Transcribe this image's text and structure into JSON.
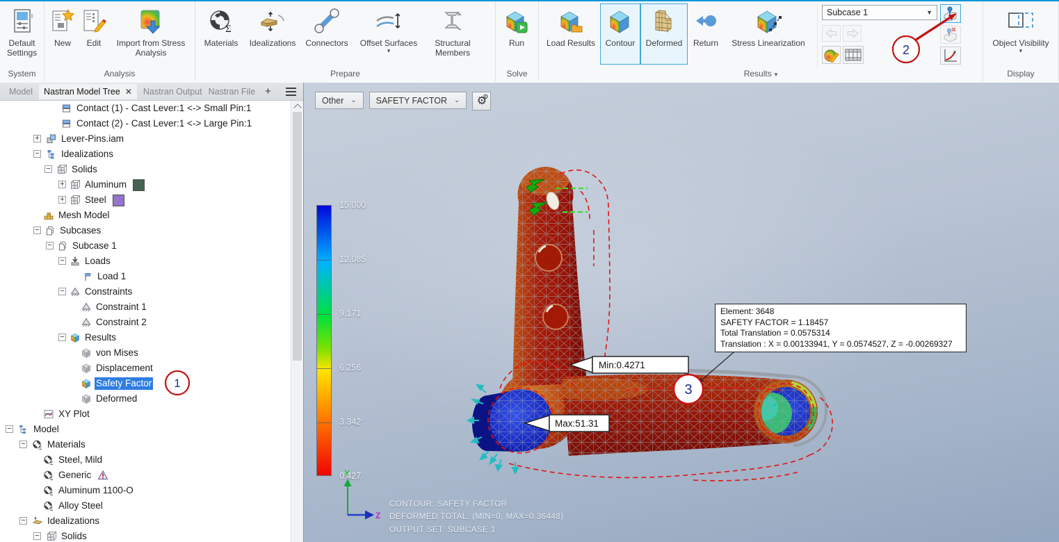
{
  "ribbon": {
    "group_labels": {
      "system": "System",
      "analysis": "Analysis",
      "prepare": "Prepare",
      "solve": "Solve",
      "results": "Results",
      "display": "Display"
    },
    "buttons": {
      "default_settings": "Default Settings",
      "new": "New",
      "edit": "Edit",
      "import_from_stress": "Import from Stress Analysis",
      "materials": "Materials",
      "idealizations": "Idealizations",
      "connectors": "Connectors",
      "offset_surfaces": "Offset Surfaces",
      "structural_members": "Structural Members",
      "run": "Run",
      "load_results": "Load Results",
      "contour": "Contour",
      "deformed": "Deformed",
      "return": "Return",
      "stress_linearization": "Stress Linearization",
      "object_visibility": "Object Visibility"
    },
    "active_buttons": [
      "Contour",
      "Deformed"
    ],
    "subcase_selector": "Subcase 1",
    "accent_color": "#0696d7"
  },
  "panel": {
    "tabs": {
      "model": "Model",
      "nastran_model_tree": "Nastran Model Tree",
      "close": "✕",
      "nastran_output": "Nastran Output",
      "nastran_file": "Nastran File",
      "add": "+"
    },
    "selection_color": "#2e7de1",
    "tree": [
      {
        "label": "Contact (1) - Cast Lever:1 <-> Small Pin:1",
        "ix": 88,
        "icon": "contact"
      },
      {
        "label": "Contact (2) - Cast Lever:1 <-> Large Pin:1",
        "ix": 88,
        "icon": "contact"
      },
      {
        "label": "Lever-Pins.iam",
        "ex": 48,
        "pm": "+",
        "ix": 66,
        "icon": "assembly"
      },
      {
        "label": "Idealizations",
        "ex": 48,
        "pm": "-",
        "ix": 66,
        "icon": "ideal"
      },
      {
        "label": "Solids",
        "ex": 64,
        "pm": "-",
        "ix": 81,
        "icon": "solids"
      },
      {
        "label": "Aluminum",
        "ex": 84,
        "pm": "+",
        "ix": 100,
        "icon": "solids",
        "swatch": "#456253"
      },
      {
        "label": "Steel",
        "ex": 84,
        "pm": "+",
        "ix": 100,
        "icon": "solids",
        "swatch": "#9674ce"
      },
      {
        "label": "Mesh Model",
        "ix": 62,
        "icon": "mesh"
      },
      {
        "label": "Subcases",
        "ex": 48,
        "pm": "-",
        "ix": 64,
        "icon": "pages"
      },
      {
        "label": "Subcase 1",
        "ex": 66,
        "pm": "-",
        "ix": 82,
        "icon": "pages"
      },
      {
        "label": "Loads",
        "ex": 84,
        "pm": "-",
        "ix": 100,
        "icon": "loads"
      },
      {
        "label": "Load 1",
        "ix": 118,
        "icon": "load1"
      },
      {
        "label": "Constraints",
        "ex": 84,
        "pm": "-",
        "ix": 100,
        "icon": "constraint"
      },
      {
        "label": "Constraint 1",
        "ix": 116,
        "icon": "constraint"
      },
      {
        "label": "Constraint 2",
        "ix": 116,
        "icon": "constraint"
      },
      {
        "label": "Results",
        "ex": 84,
        "pm": "-",
        "ix": 100,
        "icon": "cubecolor"
      },
      {
        "label": "von Mises",
        "ix": 116,
        "icon": "cubegrey"
      },
      {
        "label": "Displacement",
        "ix": 116,
        "icon": "cubegrey"
      },
      {
        "label": "Safety Factor",
        "ix": 116,
        "icon": "cubecolor",
        "sel": true
      },
      {
        "label": "Deformed",
        "ix": 116,
        "icon": "cubegrey"
      },
      {
        "label": "XY Plot",
        "ix": 62,
        "icon": "xyplot"
      },
      {
        "label": "Model",
        "ex": 8,
        "pm": "-",
        "ix": 26,
        "icon": "model"
      },
      {
        "label": "Materials",
        "ex": 28,
        "pm": "-",
        "ix": 46,
        "icon": "material"
      },
      {
        "label": "Steel, Mild",
        "ix": 62,
        "icon": "material"
      },
      {
        "label": "Generic",
        "ix": 62,
        "icon": "material",
        "warn": true
      },
      {
        "label": "Aluminum 1100-O",
        "ix": 62,
        "icon": "material"
      },
      {
        "label": "Alloy Steel",
        "ix": 62,
        "icon": "material"
      },
      {
        "label": "Idealizations",
        "ex": 28,
        "pm": "-",
        "ix": 46,
        "icon": "ideal2"
      },
      {
        "label": "Solids",
        "ex": 48,
        "pm": "-",
        "ix": 66,
        "icon": "solids"
      }
    ]
  },
  "viewport": {
    "result_category_combo": "Other",
    "result_type_combo": "SAFETY FACTOR",
    "legend": {
      "ticks": [
        "15.000",
        "12.085",
        "9.171",
        "6.256",
        "3.342",
        "0.427"
      ]
    },
    "min_label": "Min:0.4271",
    "max_label": "Max:51.31",
    "tooltip": {
      "lines": [
        "Element: 3648",
        "SAFETY FACTOR  = 1.18457",
        "Total Translation = 0.0575314",
        "Translation : X = 0.00133941, Y = 0.0574527, Z = -0.00269327"
      ]
    },
    "status_lines": [
      "CONTOUR: SAFETY FACTOR",
      "DEFORMED TOTAL: (MIN=0, MAX=0.36448)",
      "OUTPUT SET: SUBCASE 1"
    ],
    "triad": {
      "y": "Y",
      "z": "Z"
    }
  },
  "annotations": {
    "badge1": "1",
    "badge2": "2",
    "badge3": "3",
    "color": "#c41212",
    "number_color": "#1a2f8f"
  }
}
